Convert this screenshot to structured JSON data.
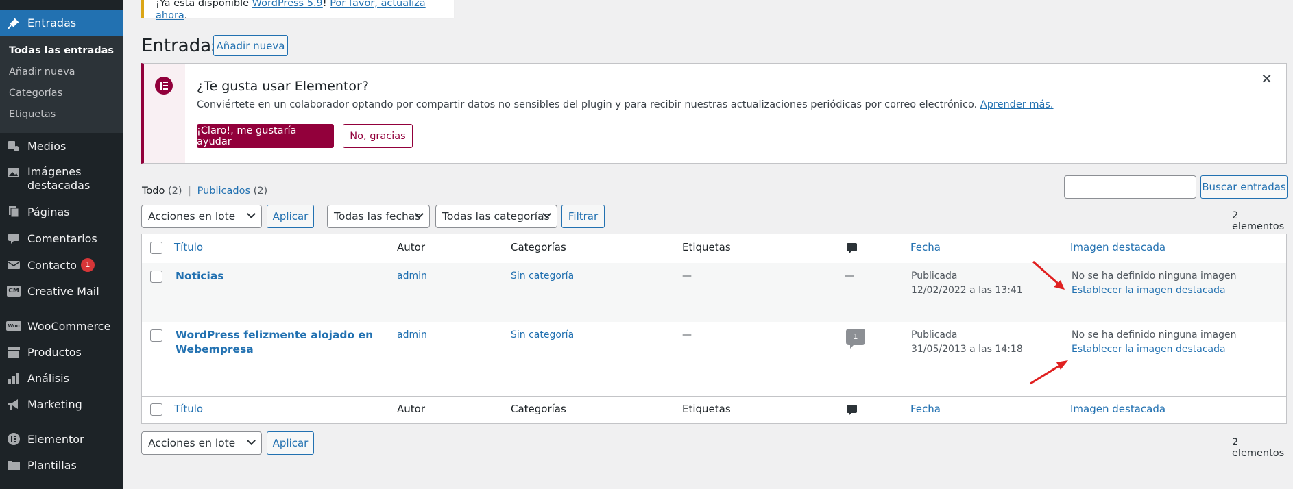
{
  "sidebar": {
    "active": "Entradas",
    "submenu": [
      "Todas las entradas",
      "Añadir nueva",
      "Categorías",
      "Etiquetas"
    ],
    "items": [
      {
        "label": "Medios",
        "icon": "media-icon"
      },
      {
        "label": "Imágenes",
        "label2": "destacadas",
        "icon": "images-icon"
      },
      {
        "label": "Páginas",
        "icon": "pages-icon"
      },
      {
        "label": "Comentarios",
        "icon": "comments-icon"
      },
      {
        "label": "Contacto",
        "icon": "mail-icon",
        "badge": "1"
      },
      {
        "label": "Creative Mail",
        "icon": "cm-icon",
        "icon_text": "CM"
      },
      {
        "label": "WooCommerce",
        "icon": "woo-icon",
        "icon_text": "Woo"
      },
      {
        "label": "Productos",
        "icon": "archive-icon"
      },
      {
        "label": "Análisis",
        "icon": "chart-icon"
      },
      {
        "label": "Marketing",
        "icon": "megaphone-icon"
      },
      {
        "label": "Elementor",
        "icon": "elementor-icon"
      },
      {
        "label": "Plantillas",
        "icon": "folder-icon"
      }
    ]
  },
  "update_notice": {
    "prefix": "¡Ya está disponible ",
    "link1": "WordPress 5.9",
    "sep": "! ",
    "link2": "Por favor, actualiza ahora",
    "suffix": "."
  },
  "page": {
    "title": "Entradas",
    "add_new": "Añadir nueva"
  },
  "elementor_notice": {
    "title": "¿Te gusta usar Elementor?",
    "description": "Conviértete en un colaborador optando por compartir datos no sensibles del plugin y para recibir nuestras actualizaciones periódicas por correo electrónico.",
    "learn_more": "Aprender más.",
    "yes_button": "¡Claro!, me gustaría ayudar",
    "no_button": "No, gracias",
    "close": "✕"
  },
  "views": {
    "all": "Todo",
    "all_count": "(2)",
    "sep": "|",
    "published": "Publicados",
    "published_count": "(2)"
  },
  "search": {
    "value": "",
    "button": "Buscar entradas"
  },
  "bulk_actions": {
    "selected": "Acciones en lote",
    "apply": "Aplicar"
  },
  "date_filter": {
    "selected": "Todas las fechas"
  },
  "category_filter": {
    "selected": "Todas las categorías"
  },
  "filter_button": "Filtrar",
  "item_count": "2 elementos",
  "table": {
    "columns": [
      "Título",
      "Autor",
      "Categorías",
      "Etiquetas",
      "Fecha",
      "Imagen destacada"
    ],
    "rows": [
      {
        "title": "Noticias",
        "title2": "",
        "author": "admin",
        "categories": "Sin categoría",
        "tags": "—",
        "comments": "—",
        "status": "Publicada",
        "date": "12/02/2022 a las 13:41",
        "image_status": "No se ha definido ninguna imagen",
        "image_link": "Establecer la imagen destacada"
      },
      {
        "title": "WordPress felizmente alojado en",
        "title2": "Webempresa",
        "author": "admin",
        "categories": "Sin categoría",
        "tags": "—",
        "comments": "1",
        "status": "Publicada",
        "date": "31/05/2013 a las 14:18",
        "image_status": "No se ha definido ninguna imagen",
        "image_link": "Establecer la imagen destacada"
      }
    ]
  },
  "colors": {
    "accent": "#2271b1",
    "elementor": "#92003b",
    "sidebar": "#1d2327",
    "arrow": "#e02020"
  }
}
